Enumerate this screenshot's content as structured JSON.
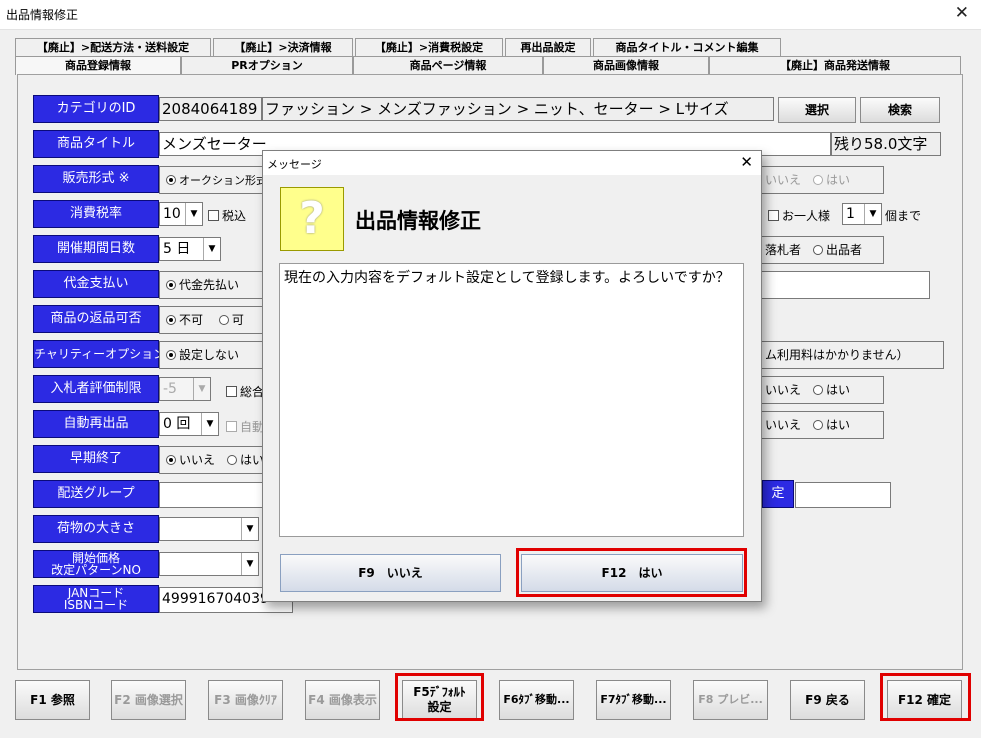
{
  "window": {
    "title": "出品情報修正",
    "close": "✕"
  },
  "tabs_top": [
    "【廃止】>配送方法・送料設定",
    "【廃止】>決済情報",
    "【廃止】>消費税設定",
    "再出品設定",
    "商品タイトル・コメント編集"
  ],
  "tabs_bottom": [
    "商品登録情報",
    "PRオプション",
    "商品ページ情報",
    "商品画像情報",
    "【廃止】商品発送情報"
  ],
  "form": {
    "category": {
      "label": "カテゴリのID",
      "id": "2084064189",
      "path": "ファッション > メンズファッション > ニット、セーター > Lサイズ",
      "select_button": "選択",
      "search_button": "検索"
    },
    "title": {
      "label": "商品タイトル",
      "value": "メンズセーター",
      "remaining": "残り58.0文字"
    },
    "sales_format": {
      "label": "販売形式 ※",
      "option": "オークション形式で",
      "no": "いいえ",
      "yes": "はい"
    },
    "tax": {
      "label": "消費税率",
      "rate": "10",
      "tax_included": "税込",
      "per_person": "お一人様",
      "qty": "1",
      "qty_suffix": "個まで"
    },
    "period": {
      "label": "開催期間日数",
      "value": "5 日",
      "winner": "落札者",
      "seller": "出品者"
    },
    "payment": {
      "label": "代金支払い",
      "option": "代金先払い"
    },
    "returns": {
      "label": "商品の返品可否",
      "no": "不可",
      "yes": "可"
    },
    "charity": {
      "label": "チャリティーオプション",
      "option": "設定しない",
      "note": "ム利用料はかかりません）"
    },
    "bidder": {
      "label": "入札者評価制限",
      "value": "-5",
      "check": "総合",
      "no": "いいえ",
      "yes": "はい"
    },
    "relist": {
      "label": "自動再出品",
      "value": "0 回",
      "check": "自動",
      "no": "いいえ",
      "yes": "はい"
    },
    "early_end": {
      "label": "早期終了",
      "no": "いいえ",
      "yes": "はい"
    },
    "shipping_group": {
      "label": "配送グループ",
      "right_label": "定"
    },
    "package_size": {
      "label": "荷物の大きさ"
    },
    "start_price": {
      "label_line1": "開始価格",
      "label_line2": "改定パターンNO"
    },
    "jan": {
      "label_line1": "JANコード",
      "label_line2": "ISBNコード",
      "value": "499916704039"
    }
  },
  "dialog": {
    "window_title": "メッセージ",
    "close": "✕",
    "icon": "?",
    "heading": "出品情報修正",
    "message": "現在の入力内容をデフォルト設定として登録します。よろしいですか？",
    "no_button": "F9　いいえ",
    "yes_button": "F12　はい"
  },
  "footer": {
    "f1": "F1 参照",
    "f2": "F2 画像選択",
    "f3": "F3 画像ｸﾘｱ",
    "f4": "F4 画像表示",
    "f5_line1": "F5ﾃﾞﾌｫﾙﾄ",
    "f5_line2": "設定",
    "f6": "F6ﾀﾌﾞ移動...",
    "f7": "F7ﾀﾌﾞ移動...",
    "f8": "F8 プレビ...",
    "f9": "F9 戻る",
    "f12": "F12 確定"
  },
  "colors": {
    "label_bg": "#2c2ae3",
    "highlight": "#e00000",
    "question_icon_bg": "#ffff8c"
  }
}
